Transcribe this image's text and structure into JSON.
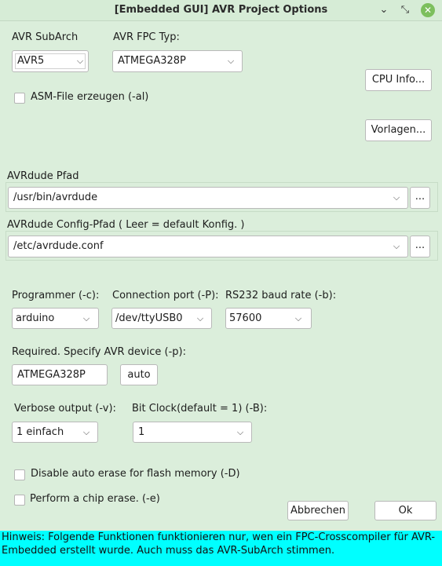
{
  "window": {
    "title": "[Embedded GUI] AVR Project Options",
    "minimize_glyph": "⌄",
    "restore_glyph": "⤡",
    "close_glyph": "✕"
  },
  "subarch": {
    "label": "AVR SubArch",
    "value": "AVR5"
  },
  "fpc_typ": {
    "label": "AVR FPC Typ:",
    "value": "ATMEGA328P"
  },
  "cpu_info_button": "CPU Info...",
  "asm_file": {
    "label": "ASM-File erzeugen (-al)",
    "checked": false
  },
  "vorlagen_button": "Vorlagen...",
  "avrdude_path": {
    "label": "AVRdude Pfad",
    "value": "/usr/bin/avrdude",
    "browse": "..."
  },
  "avrdude_config": {
    "label": "AVRdude Config-Pfad ( Leer = default Konfig. )",
    "value": "/etc/avrdude.conf",
    "browse": "..."
  },
  "programmer": {
    "label": "Programmer (-c):",
    "value": "arduino"
  },
  "connection_port": {
    "label": "Connection port (-P):",
    "value": "/dev/ttyUSB0"
  },
  "baud_rate": {
    "label": "RS232 baud rate (-b):",
    "value": "57600"
  },
  "avr_device": {
    "label": "Required. Specify AVR device (-p):",
    "value": "ATMEGA328P",
    "auto_button": "auto"
  },
  "verbose": {
    "label": "Verbose output (-v):",
    "value": "1 einfach"
  },
  "bit_clock": {
    "label": "Bit Clock(default = 1) (-B):",
    "value": "1"
  },
  "disable_erase": {
    "label": "Disable auto erase for flash memory (-D)",
    "checked": false
  },
  "chip_erase": {
    "label": "Perform a chip erase. (-e)",
    "checked": false
  },
  "buttons": {
    "cancel": "Abbrechen",
    "ok": "Ok"
  },
  "hint": {
    "line1": "Hinweis: Folgende Funktionen funktionieren nur, wen ein FPC-Crosscompiler für AVR-",
    "line2": "Embedded erstellt wurde. Auch muss das AVR-SubArch stimmen."
  },
  "icons": {
    "dropdown": "chevron-down-icon"
  },
  "colors": {
    "background": "#dbeedb",
    "hint_background": "#00ffff",
    "close_button": "#7cbf5d"
  }
}
